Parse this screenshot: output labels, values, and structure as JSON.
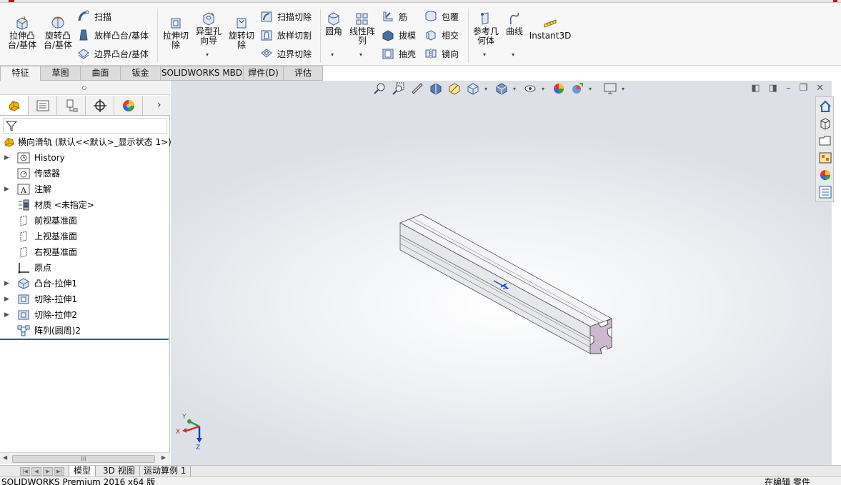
{
  "ribbon": {
    "features": {
      "extrude_boss": "拉伸凸\n台/基体",
      "revolve_boss": "旋转凸\n台/基体",
      "sweep": "扫描",
      "loft_boss": "放样凸台/基体",
      "boundary_boss": "边界凸台/基体",
      "extrude_cut": "拉伸切\n除",
      "hole_wizard": "异型孔\n向导",
      "revolve_cut": "旋转切\n除",
      "swept_cut": "扫描切除",
      "lofted_cut": "放样切割",
      "boundary_cut": "边界切除",
      "fillet": "圆角",
      "linear_pattern": "线性阵\n列",
      "rib": "筋",
      "draft": "拔模",
      "shell": "抽壳",
      "wrap": "包覆",
      "intersect": "相交",
      "mirror": "镜向",
      "reference_geometry": "参考几\n何体",
      "curves": "曲线",
      "instant3d": "Instant3D"
    }
  },
  "command_tabs": [
    "特征",
    "草图",
    "曲面",
    "钣金",
    "SOLIDWORKS MBD",
    "焊件(D)",
    "评估"
  ],
  "feature_tree": {
    "root": "横向滑轨 (默认<<默认>_显示状态 1>)",
    "items": [
      {
        "label": "History",
        "expandable": true,
        "icon": "history-icon"
      },
      {
        "label": "传感器",
        "expandable": false,
        "icon": "sensor-icon"
      },
      {
        "label": "注解",
        "expandable": true,
        "icon": "annotation-icon"
      },
      {
        "label": "材质 <未指定>",
        "expandable": false,
        "icon": "material-icon"
      },
      {
        "label": "前视基准面",
        "expandable": false,
        "icon": "plane-icon"
      },
      {
        "label": "上视基准面",
        "expandable": false,
        "icon": "plane-icon"
      },
      {
        "label": "右视基准面",
        "expandable": false,
        "icon": "plane-icon"
      },
      {
        "label": "原点",
        "expandable": false,
        "icon": "origin-icon"
      },
      {
        "label": "凸台-拉伸1",
        "expandable": true,
        "icon": "boss-extrude-icon"
      },
      {
        "label": "切除-拉伸1",
        "expandable": true,
        "icon": "cut-extrude-icon"
      },
      {
        "label": "切除-拉伸2",
        "expandable": true,
        "icon": "cut-extrude-icon"
      },
      {
        "label": "阵列(圆周)2",
        "expandable": false,
        "icon": "circular-pattern-icon"
      }
    ]
  },
  "scrollbar_label": "III",
  "bottom_tabs": [
    "模型",
    "3D 视图",
    "运动算例 1"
  ],
  "status": {
    "left": "SOLIDWORKS Premium 2016 x64 版",
    "right": "在编辑 零件"
  },
  "triad": {
    "x": "X",
    "y": "Y",
    "z": "Z"
  },
  "colors": {
    "accent_blue": "#2a5db0",
    "profile_face": "#cdb9cf",
    "part_body": "#e9eaee"
  }
}
